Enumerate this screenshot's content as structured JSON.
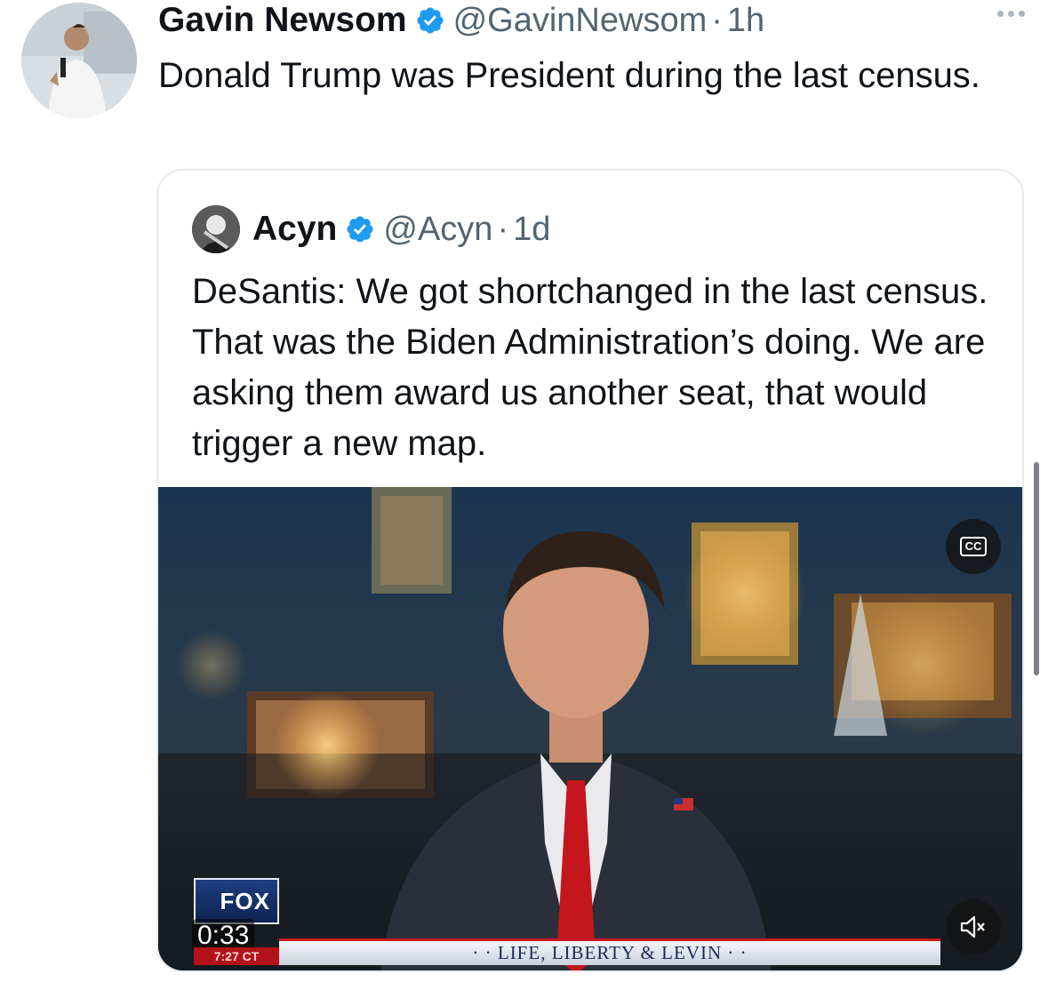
{
  "tweet": {
    "author_name": "Gavin Newsom",
    "handle": "@GavinNewsom",
    "separator": "·",
    "time": "1h",
    "text": "Donald Trump was President during the last census.",
    "verified_icon": "verified-badge-icon",
    "more_icon": "more-options-icon"
  },
  "quoted": {
    "author_name": "Acyn",
    "handle": "@Acyn",
    "separator": "·",
    "time": "1d",
    "text": "DeSantis: We got shortchanged in the last census. That was the Biden Administration’s doing. We are asking them award us another seat, that would trigger a new map."
  },
  "video": {
    "duration": "0:33",
    "network_logo": "FOX",
    "clock": "7:27 CT",
    "show_title": "· · LIFE, LIBERTY & LEVIN · ·",
    "cc_label": "CC",
    "cc_icon": "closed-captions-icon",
    "mute_icon": "muted-speaker-icon"
  },
  "colors": {
    "text_primary": "#0f1419",
    "text_secondary": "#536471",
    "verified_blue": "#1d9bf0",
    "border": "#e6eaed"
  }
}
